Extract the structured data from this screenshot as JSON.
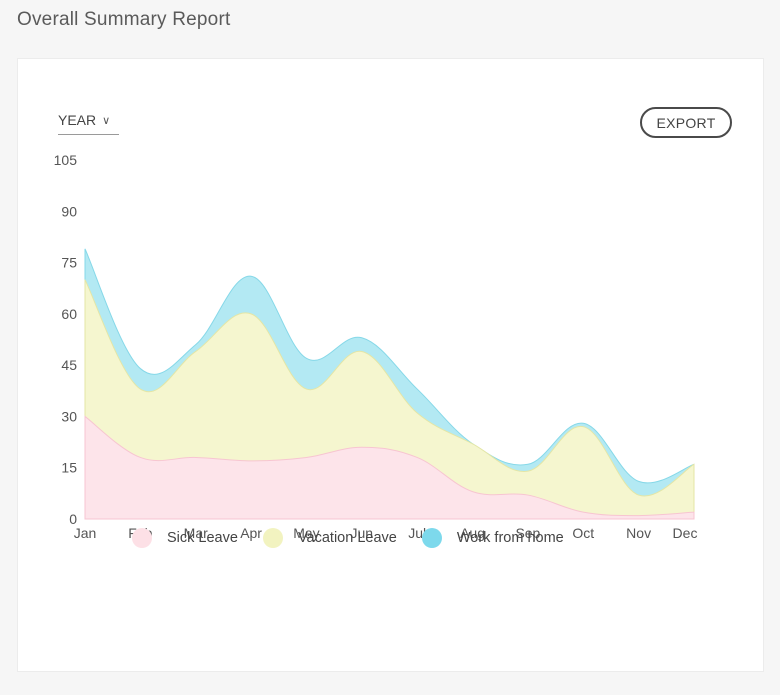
{
  "page": {
    "title": "Overall Summary Report"
  },
  "controls": {
    "period_label": "YEAR",
    "export_label": "EXPORT"
  },
  "colors": {
    "sick": "#fde4ea",
    "vacation": "#f5f6cf",
    "wfh": "#b3e9f3",
    "sick_legend": "#fde0e6",
    "vacation_legend": "#f2f3c0",
    "wfh_legend": "#7dd9ec"
  },
  "chart_data": {
    "type": "area",
    "stacked": true,
    "categories": [
      "Jan",
      "Feb",
      "Mar",
      "Apr",
      "May",
      "Jun",
      "Jul",
      "Aug",
      "Sep",
      "Oct",
      "Nov",
      "Dec"
    ],
    "series": [
      {
        "name": "Sick Leave",
        "values": [
          30,
          18,
          18,
          17,
          18,
          21,
          18,
          8,
          7,
          2,
          1,
          2
        ]
      },
      {
        "name": "Vacation Leave",
        "values": [
          40,
          20,
          31,
          43,
          20,
          28,
          13,
          14,
          7,
          25,
          6,
          14
        ]
      },
      {
        "name": "Work from home",
        "values": [
          9,
          6,
          2,
          11,
          9,
          4,
          7,
          0,
          2,
          1,
          4,
          0
        ]
      }
    ],
    "yticks": [
      0,
      15,
      30,
      45,
      60,
      75,
      90,
      105
    ],
    "ylim": [
      0,
      105
    ],
    "legend_position": "bottom",
    "grid": false
  }
}
